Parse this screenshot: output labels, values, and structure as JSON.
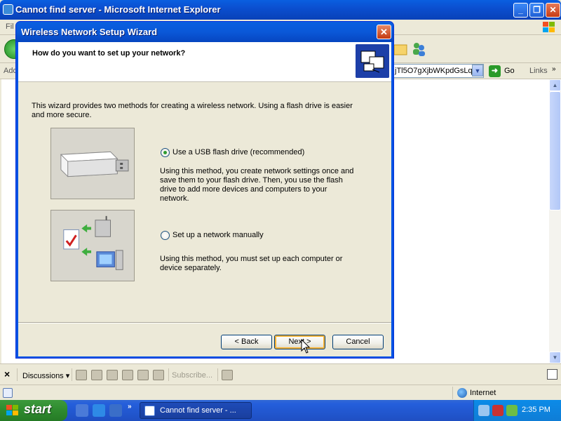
{
  "ie": {
    "title": "Cannot find server - Microsoft Internet Explorer",
    "menu_partial": "Fil",
    "address_label": "Add",
    "address_value": "jTl5O7gXjbWKpdGsLq",
    "go_label": "Go",
    "links_label": "Links",
    "links_chevron": "»",
    "discussions_label": "Discussions ▾",
    "subscribe_label": "Subscribe...",
    "zone_label": "Internet"
  },
  "window_controls": {
    "minimize": "_",
    "maximize": "❐",
    "close": "✕"
  },
  "wizard": {
    "title": "Wireless Network Setup Wizard",
    "heading": "How do you want to set up your network?",
    "intro": "This wizard provides two methods for creating a wireless network. Using a flash drive is easier and more secure.",
    "options": [
      {
        "label": "Use a USB flash drive (recommended)",
        "selected": true,
        "description": "Using this method, you create network settings once and save them to your flash drive. Then, you use the flash drive to add more devices and computers to your network."
      },
      {
        "label": "Set up a network manually",
        "selected": false,
        "description": "Using this method, you must set up each computer or device separately."
      }
    ],
    "buttons": {
      "back": "< Back",
      "next": "Next >",
      "cancel": "Cancel"
    }
  },
  "taskbar": {
    "start_label": "start",
    "task_label": "Cannot find server - ...",
    "clock": "2:35 PM",
    "chevron": "»"
  },
  "colors": {
    "title_blue": "#0a58d8",
    "start_green": "#2e8a2e",
    "dialog_bg": "#ece9d8",
    "close_red": "#c43a10"
  }
}
